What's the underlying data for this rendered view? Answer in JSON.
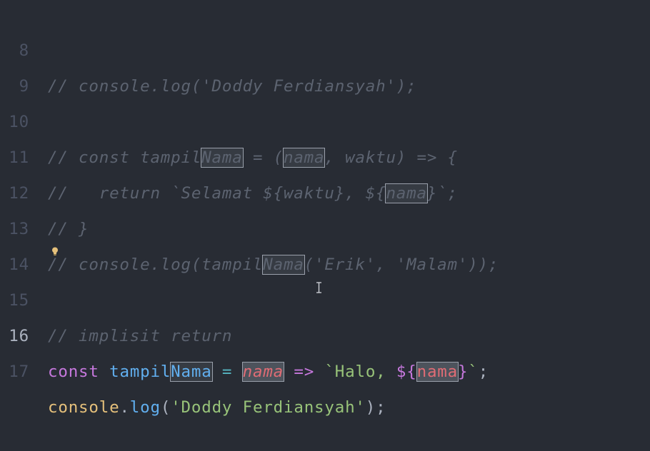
{
  "editor": {
    "lines": [
      {
        "number": "8",
        "text": "// console.log('Doddy Ferdiansyah');"
      },
      {
        "number": "9",
        "text": ""
      },
      {
        "number": "10",
        "pre": "// const tampil",
        "hl1": "Nama",
        "mid1": " = (",
        "hl2": "nama",
        "post": ", waktu) => {"
      },
      {
        "number": "11",
        "pre": "//   return `Selamat ${waktu}, ${",
        "hl1": "nama",
        "post": "}`;"
      },
      {
        "number": "12",
        "text": "// }"
      },
      {
        "number": "13",
        "pre": "// console.log(tampil",
        "hl1": "Nama",
        "post": "('Erik', 'Malam'));"
      },
      {
        "number": "14",
        "text": ""
      },
      {
        "number": "15",
        "text": "// implisit return"
      },
      {
        "number": "16",
        "kw": "const",
        "fn_pre": "tampil",
        "fn_hl": "Nama",
        "eq": "=",
        "param": "nama",
        "arrow": "=>",
        "tpl_open": "`Halo, ",
        "interp_open": "${",
        "ivar": "nama",
        "interp_close": "}",
        "tpl_close": "`",
        "semi": ";"
      },
      {
        "number": "17",
        "obj": "console",
        "dot": ".",
        "method": "log",
        "open": "(",
        "str": "'Doddy Ferdiansyah'",
        "close": ")",
        "semi": ";"
      }
    ]
  },
  "icons": {
    "lightbulb": "lightbulb-icon",
    "cursor": "ibeam-cursor-icon"
  }
}
